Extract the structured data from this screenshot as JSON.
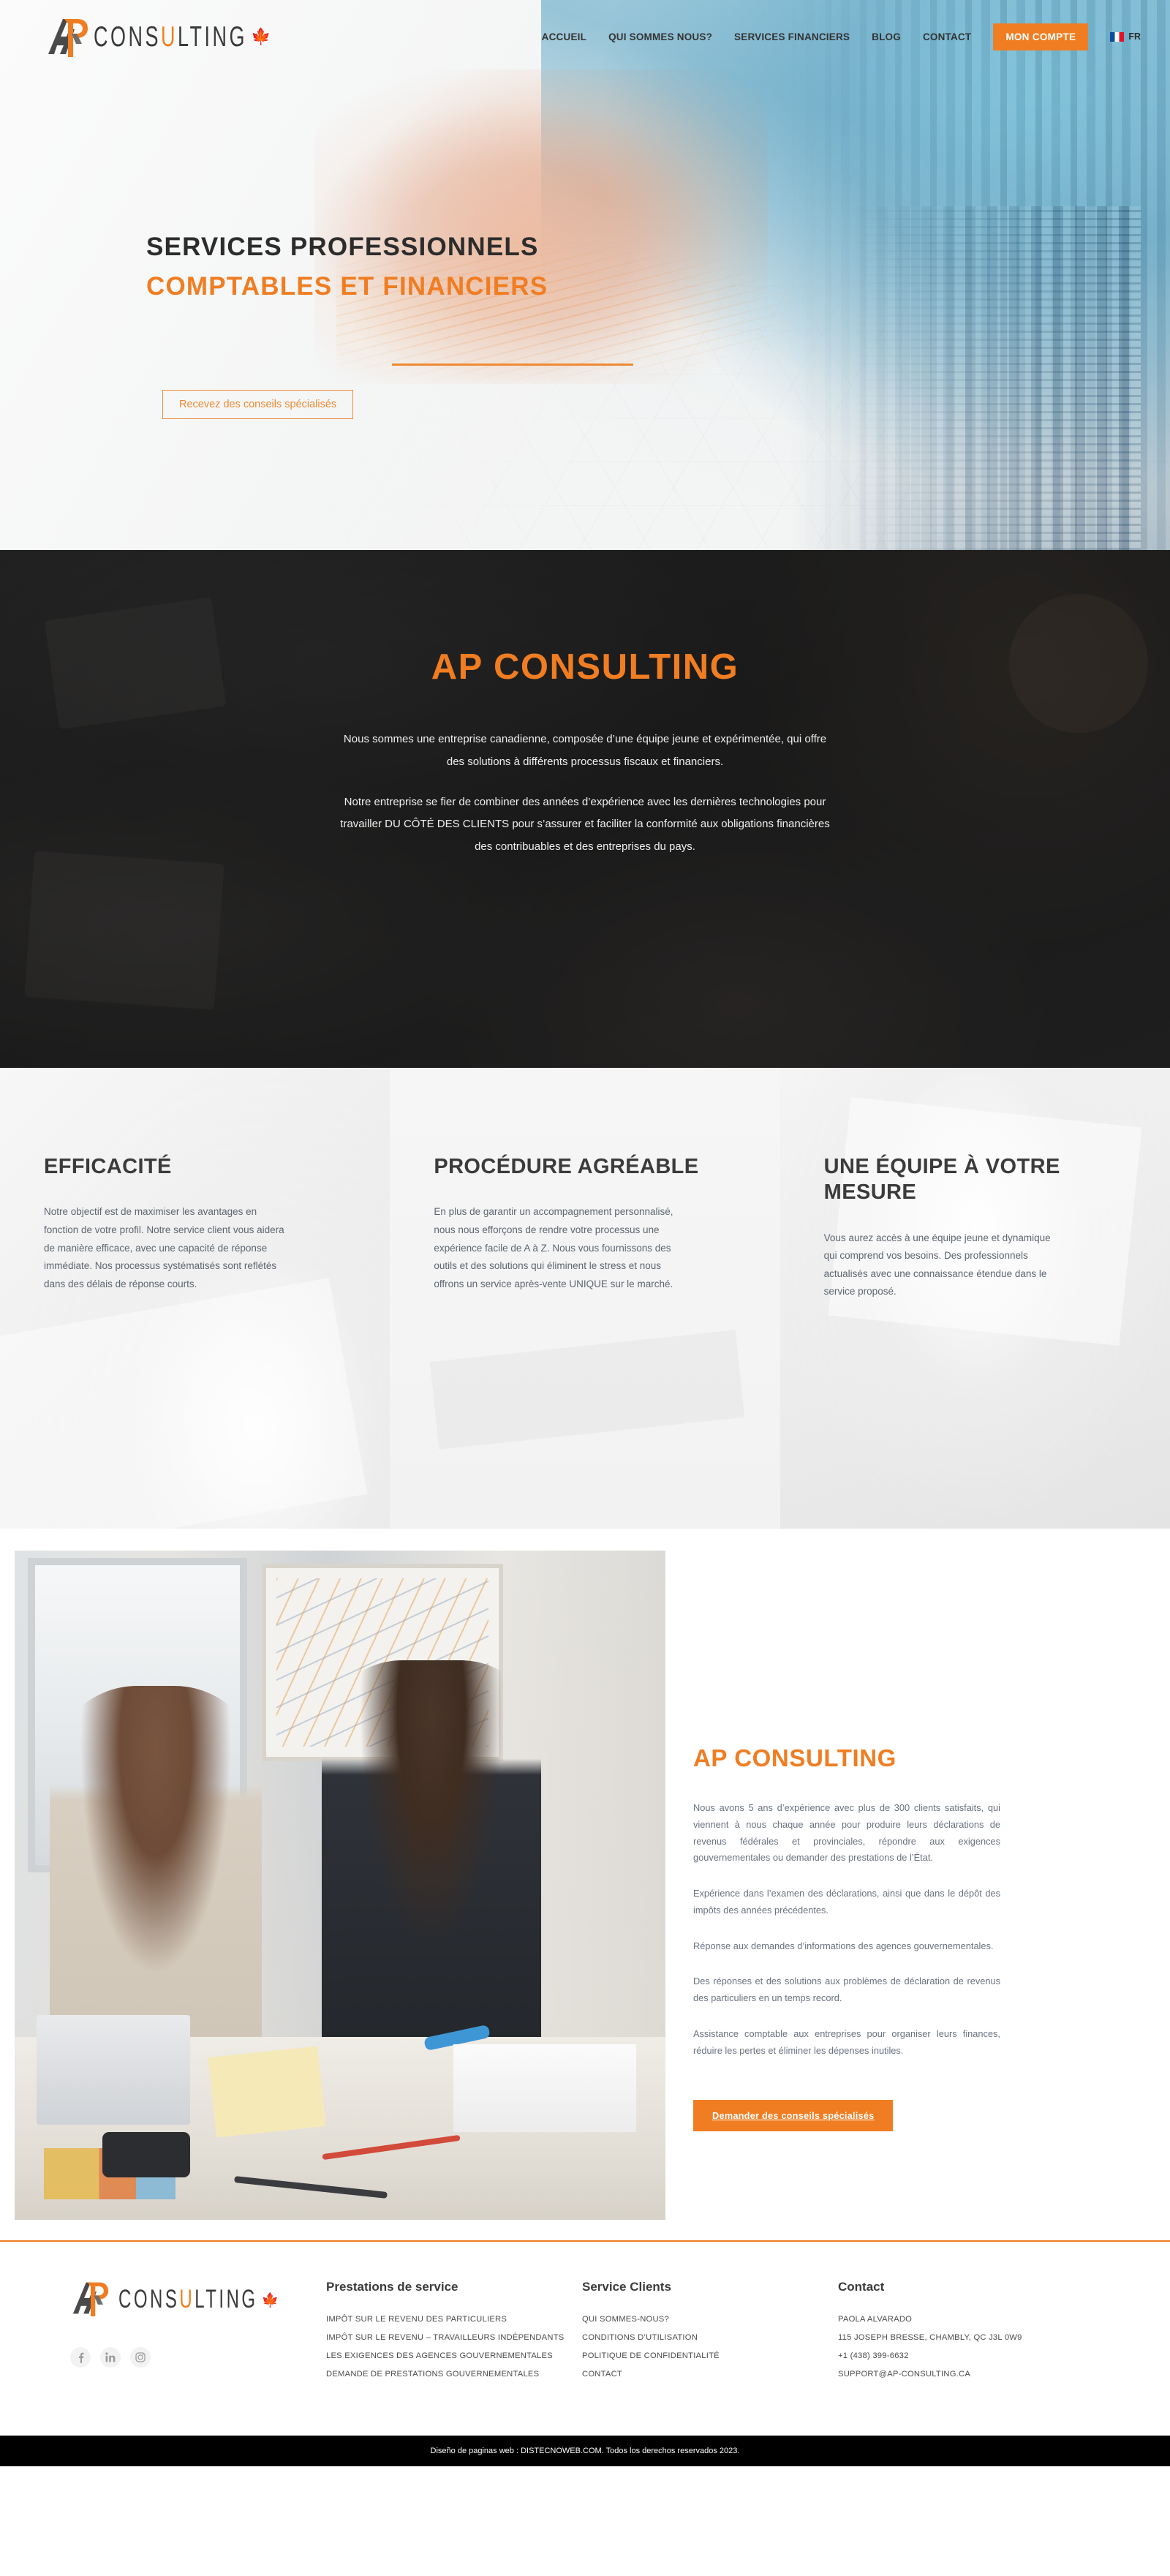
{
  "brand": {
    "name_prefix": "AP",
    "wordmark_c": "C",
    "wordmark_o": "O",
    "wordmark_n": "N",
    "wordmark_s": "S",
    "wordmark_u": "U",
    "wordmark_l": "L",
    "wordmark_t": "T",
    "wordmark_i": "I",
    "wordmark_n2": "N",
    "wordmark_g": "G",
    "wordmark_plain": "CONS",
    "wordmark_accent": "U",
    "wordmark_tail": "LTING",
    "maple_icon": "maple-leaf-icon",
    "accent_color": "#f07d22",
    "dark_color": "#3a3a3a"
  },
  "nav": {
    "items": [
      {
        "label": "ACCUEIL",
        "name": "nav-accueil"
      },
      {
        "label": "QUI SOMMES NOUS?",
        "name": "nav-qui-sommes-nous"
      },
      {
        "label": "SERVICES FINANCIERS",
        "name": "nav-services-financiers"
      },
      {
        "label": "BLOG",
        "name": "nav-blog"
      },
      {
        "label": "CONTACT",
        "name": "nav-contact"
      }
    ],
    "account_button": "MON COMPTE",
    "language": "FR",
    "language_flag": "france-flag-icon"
  },
  "hero": {
    "line1": "SERVICES PROFESSIONNELS",
    "line2": "COMPTABLES ET FINANCIERS",
    "cta": "Recevez des conseils spécialisés"
  },
  "about": {
    "title": "AP CONSULTING",
    "paragraph1": "Nous sommes une entreprise canadienne, composée d’une équipe jeune et expérimentée, qui offre des solutions à différents processus fiscaux et financiers.",
    "paragraph2": "Notre entreprise se fier de combiner des années d’expérience avec les dernières technologies pour travailler DU CÔTÉ DES CLIENTS pour s’assurer et faciliter la conformité aux obligations financières des contribuables et des entreprises du pays."
  },
  "features": [
    {
      "title": "EFFICACITÉ",
      "body": "Notre objectif est de maximiser les avantages en fonction de votre profil. Notre service client vous aidera de manière efficace, avec une capacité de réponse immédiate. Nos processus systématisés sont reflétés dans des délais de réponse courts."
    },
    {
      "title": "PROCÉDURE AGRÉABLE",
      "body": "En plus de garantir un accompagnement personnalisé, nous nous efforçons de rendre votre processus une expérience facile de A à Z. Nous vous fournissons des outils et des solutions qui éliminent le stress et nous offrons un service après-vente UNIQUE sur le marché."
    },
    {
      "title": "UNE ÉQUIPE À VOTRE MESURE",
      "body": "Vous aurez accès à une équipe jeune et dynamique qui comprend vos besoins. Des professionnels actualisés avec une connaissance étendue dans le service proposé."
    }
  ],
  "split": {
    "title": "AP CONSULTING",
    "paragraphs": [
      "Nous avons 5 ans d’expérience avec plus de 300 clients satisfaits, qui viennent à nous chaque année pour produire leurs déclarations de revenus fédérales et provinciales, répondre aux exigences gouvernementales ou demander des prestations de l’État.",
      "Expérience dans l’examen des déclarations, ainsi que dans le dépôt des impôts des années précédentes.",
      "Réponse aux demandes d’informations des agences gouvernementales.",
      "Des réponses et des solutions aux problèmes de déclaration de revenus des particuliers en un temps record.",
      "Assistance comptable aux entreprises pour organiser leurs finances, réduire les pertes et éliminer les dépenses inutiles."
    ],
    "cta": "Demander des conseils spécialisés"
  },
  "footer": {
    "social": [
      {
        "name": "facebook-icon",
        "glyph": "f"
      },
      {
        "name": "linkedin-icon",
        "glyph": "in"
      },
      {
        "name": "instagram-icon",
        "glyph": "◙"
      }
    ],
    "col_services": {
      "heading": "Prestations de service",
      "links": [
        "IMPÔT SUR LE REVENU DES PARTICULIERS",
        "IMPÔT SUR LE REVENU – TRAVAILLEURS INDÉPENDANTS",
        "LES EXIGENCES DES AGENCES GOUVERNEMENTALES",
        "DEMANDE DE PRESTATIONS GOUVERNEMENTALES"
      ]
    },
    "col_clients": {
      "heading": "Service Clients",
      "links": [
        "QUI SOMMES-NOUS?",
        "CONDITIONS D’UTILISATION",
        "POLITIQUE DE CONFIDENTIALITÉ",
        "CONTACT"
      ]
    },
    "col_contact": {
      "heading": "Contact",
      "lines": [
        "PAOLA ALVARADO",
        "115 JOSEPH BRESSE, CHAMBLY, QC J3L 0W9",
        "+1 (438) 399-6632",
        "SUPPORT@AP-CONSULTING.CA"
      ]
    },
    "copyright": "Diseño de paginas web : DISTECNOWEB.COM. Todos los derechos reservados 2023."
  }
}
